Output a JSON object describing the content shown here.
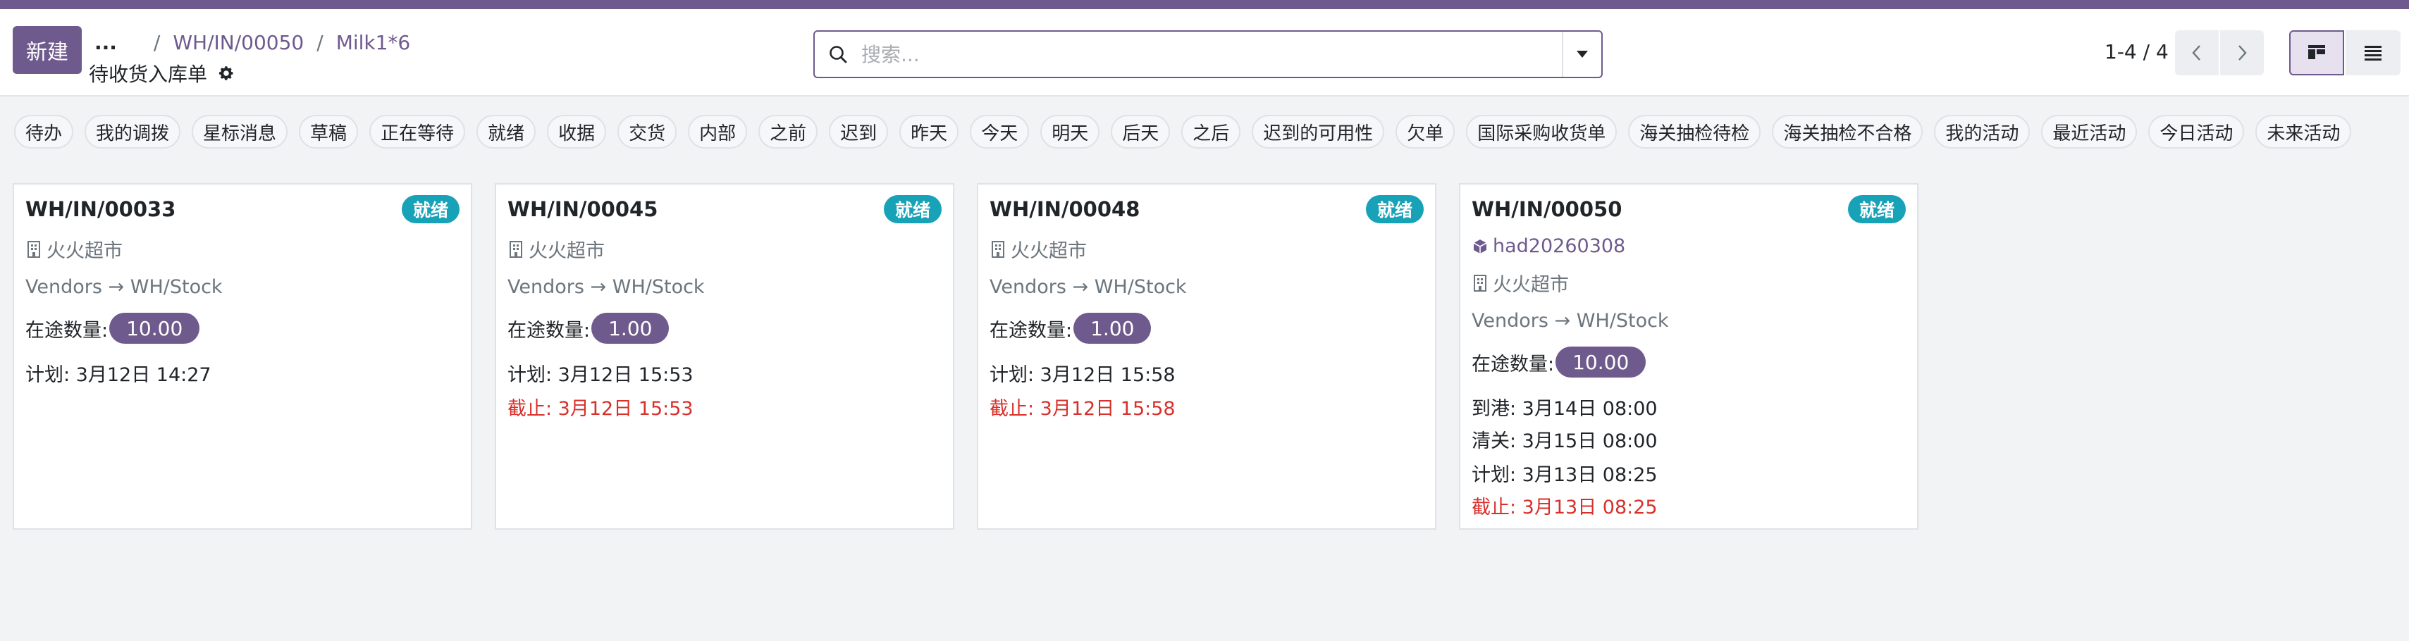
{
  "header": {
    "new_button": "新建",
    "more": "...",
    "breadcrumb": [
      "WH/IN/00050",
      "Milk1*6"
    ],
    "breadcrumb_sep": "/",
    "title": "待收货入库单"
  },
  "search": {
    "placeholder": "搜索...",
    "value": ""
  },
  "pager": {
    "text": "1-4 / 4"
  },
  "filters": [
    "待办",
    "我的调拨",
    "星标消息",
    "草稿",
    "正在等待",
    "就绪",
    "收据",
    "交货",
    "内部",
    "之前",
    "迟到",
    "昨天",
    "今天",
    "明天",
    "后天",
    "之后",
    "迟到的可用性",
    "欠单",
    "国际采购收货单",
    "海关抽检待检",
    "海关抽检不合格",
    "我的活动",
    "最近活动",
    "今日活动",
    "未来活动"
  ],
  "labels": {
    "qty": "在途数量:",
    "route_arrow": "→"
  },
  "cards": [
    {
      "name": "WH/IN/00033",
      "status": "就绪",
      "partner": "火火超市",
      "route_from": "Vendors",
      "route_to": "WH/Stock",
      "qty": "10.00",
      "scheduled": "计划: 3月12日 14:27"
    },
    {
      "name": "WH/IN/00045",
      "status": "就绪",
      "partner": "火火超市",
      "route_from": "Vendors",
      "route_to": "WH/Stock",
      "qty": "1.00",
      "scheduled": "计划: 3月12日 15:53",
      "deadline": "截止: 3月12日 15:53"
    },
    {
      "name": "WH/IN/00048",
      "status": "就绪",
      "partner": "火火超市",
      "route_from": "Vendors",
      "route_to": "WH/Stock",
      "qty": "1.00",
      "scheduled": "计划: 3月12日 15:58",
      "deadline": "截止: 3月12日 15:58"
    },
    {
      "name": "WH/IN/00050",
      "status": "就绪",
      "lot": "had20260308",
      "partner": "火火超市",
      "route_from": "Vendors",
      "route_to": "WH/Stock",
      "qty": "10.00",
      "arrival": "到港: 3月14日 08:00",
      "clearance": "清关: 3月15日 08:00",
      "scheduled": "计划: 3月13日 08:25",
      "deadline": "截止: 3月13日 08:25"
    }
  ],
  "colors": {
    "brand": "#6f5a8e",
    "ready_badge": "#17a2b8",
    "deadline": "#d9302c"
  }
}
